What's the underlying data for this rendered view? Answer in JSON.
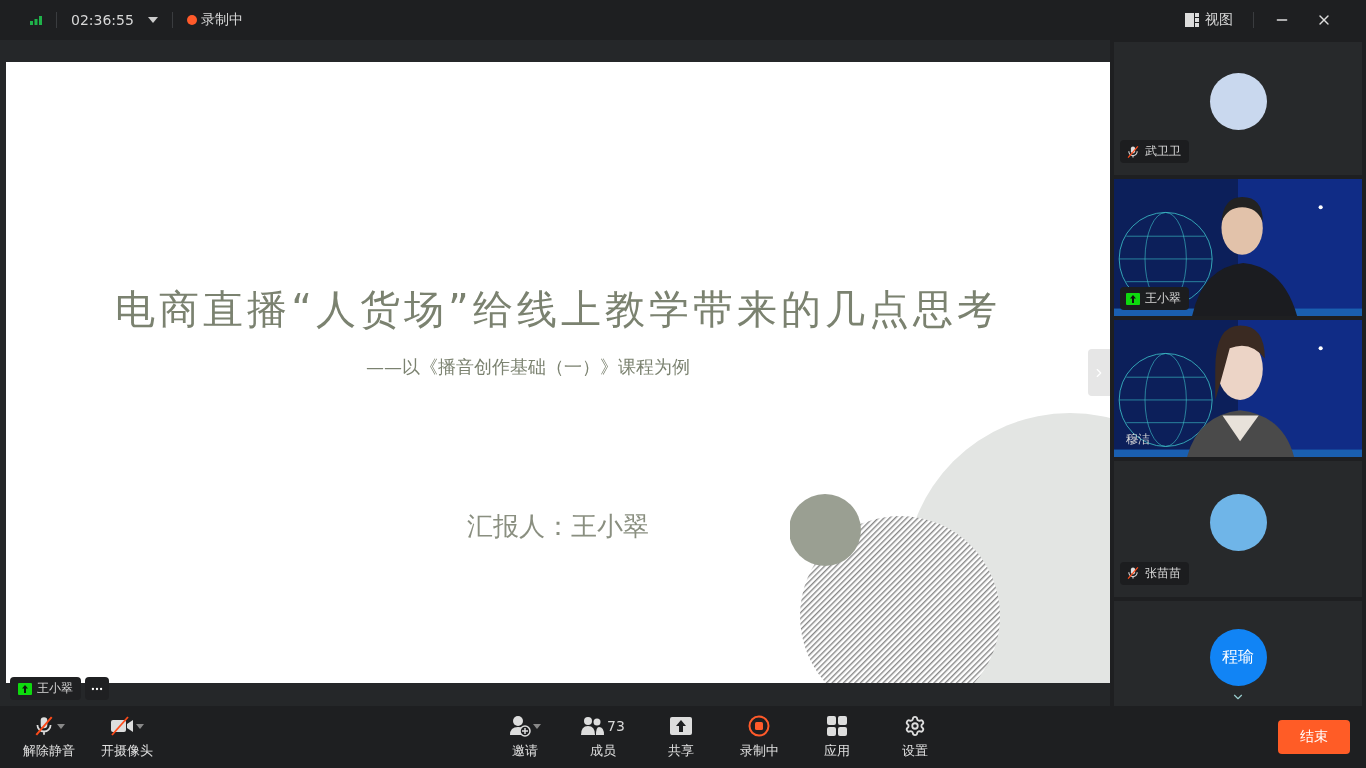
{
  "top_bar": {
    "time": "02:36:55",
    "recording_label": "录制中",
    "view_label": "视图"
  },
  "slide": {
    "title": "电商直播“人货场”给线上教学带来的几点思考",
    "subtitle": "——以《播音创作基础（一）》课程为例",
    "presenter": "汇报人：王小翠"
  },
  "speaker_tag": {
    "name": "王小翠",
    "sharing": true
  },
  "participants": [
    {
      "name": "武卫卫",
      "kind": "avatar",
      "muted": true,
      "sharing": false
    },
    {
      "name": "王小翠",
      "kind": "video",
      "muted": false,
      "sharing": true
    },
    {
      "name": "穆洁",
      "kind": "video",
      "muted": false,
      "sharing": false
    },
    {
      "name": "张苗苗",
      "kind": "avatar",
      "muted": true,
      "sharing": false
    },
    {
      "name": "程瑜",
      "kind": "initials"
    }
  ],
  "toolbar_left": [
    {
      "label": "解除静音",
      "kind": "mic-off"
    },
    {
      "label": "开摄像头",
      "kind": "camera-off"
    }
  ],
  "toolbar_center": [
    {
      "label": "邀请",
      "kind": "invite"
    },
    {
      "label": "成员",
      "kind": "members",
      "count": "73"
    },
    {
      "label": "共享",
      "kind": "share"
    },
    {
      "label": "录制中",
      "kind": "record"
    },
    {
      "label": "应用",
      "kind": "apps"
    },
    {
      "label": "设置",
      "kind": "settings"
    }
  ],
  "end_button": "结束"
}
